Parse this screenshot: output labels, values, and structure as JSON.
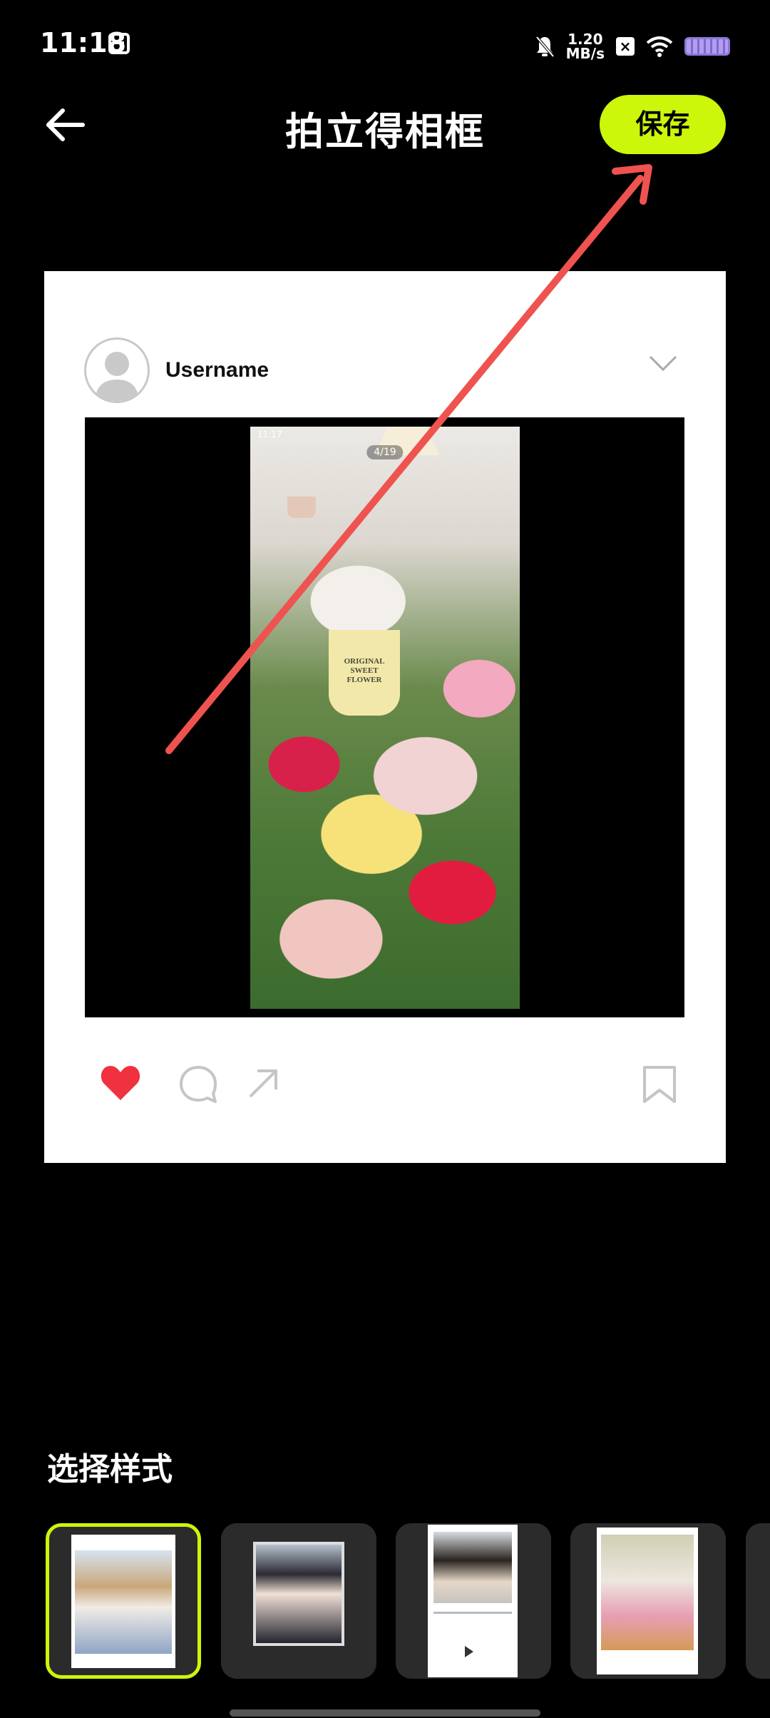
{
  "status_bar": {
    "time": "11:18",
    "net_speed_value": "1.20",
    "net_speed_unit": "MB/s"
  },
  "header": {
    "title": "拍立得相框",
    "save_label": "保存"
  },
  "card": {
    "username": "Username",
    "photo_status_time": "11:17",
    "photo_counter": "4/19",
    "pot_text": [
      "ORIGINAL",
      "SWEET",
      "FLOWER"
    ]
  },
  "styles": {
    "title": "选择样式",
    "selected_index": 0
  },
  "colors": {
    "accent": "#ccf60a",
    "like": "#f0313f",
    "annotation_arrow": "#ef5350"
  }
}
